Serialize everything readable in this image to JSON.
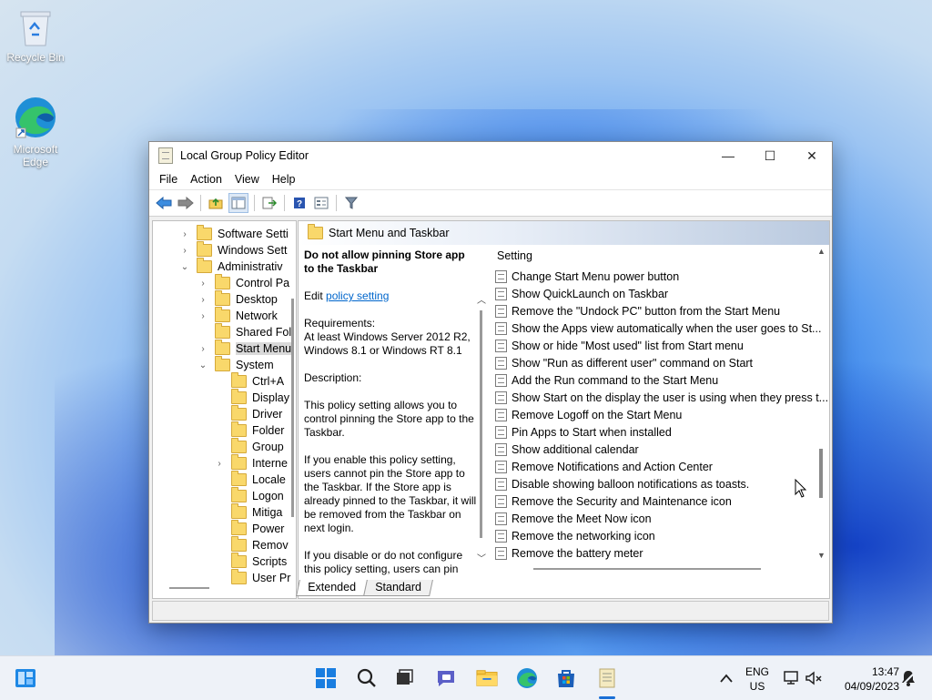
{
  "desktop": {
    "icons": [
      {
        "label_line1": "Recycle Bin",
        "label_line2": ""
      },
      {
        "label_line1": "Microsoft",
        "label_line2": "Edge"
      }
    ]
  },
  "window": {
    "title": "Local Group Policy Editor",
    "controls": {
      "minimize": "—",
      "maximize": "☐",
      "close": "✕"
    },
    "menu": [
      "File",
      "Action",
      "View",
      "Help"
    ]
  },
  "tree": {
    "items": [
      {
        "label": "Software Setti",
        "expander": "›"
      },
      {
        "label": "Windows Sett",
        "expander": "›"
      },
      {
        "label": "Administrativ",
        "expander": "⌄"
      },
      {
        "label": "Control Pa",
        "expander": "›"
      },
      {
        "label": "Desktop",
        "expander": "›"
      },
      {
        "label": "Network",
        "expander": "›"
      },
      {
        "label": "Shared Fol",
        "expander": ""
      },
      {
        "label": "Start Menu",
        "expander": "›"
      },
      {
        "label": "System",
        "expander": "⌄"
      },
      {
        "label": "Ctrl+A",
        "expander": ""
      },
      {
        "label": "Display",
        "expander": ""
      },
      {
        "label": "Driver",
        "expander": ""
      },
      {
        "label": "Folder",
        "expander": ""
      },
      {
        "label": "Group",
        "expander": ""
      },
      {
        "label": "Interne",
        "expander": "›"
      },
      {
        "label": "Locale",
        "expander": ""
      },
      {
        "label": "Logon",
        "expander": ""
      },
      {
        "label": "Mitiga",
        "expander": ""
      },
      {
        "label": "Power",
        "expander": ""
      },
      {
        "label": "Remov",
        "expander": ""
      },
      {
        "label": "Scripts",
        "expander": ""
      },
      {
        "label": "User Pr",
        "expander": ""
      }
    ]
  },
  "pane": {
    "header": "Start Menu and Taskbar",
    "description": {
      "heading": "Do not allow pinning Store app to the Taskbar",
      "edit_prefix": "Edit ",
      "edit_link": "policy setting",
      "requirements_label": "Requirements:",
      "requirements_text": "At least Windows Server 2012 R2, Windows 8.1 or Windows RT 8.1",
      "description_label": "Description:",
      "para1": "This policy setting allows you to control pinning the Store app to the Taskbar.",
      "para2": "If you enable this policy setting, users cannot pin the Store app to the Taskbar. If the Store app is already pinned to the Taskbar, it will be removed from the Taskbar on next login.",
      "para3": "If you disable or do not configure this policy setting, users can pin"
    },
    "list_header": "Setting",
    "settings": [
      "Change Start Menu power button",
      "Show QuickLaunch on Taskbar",
      "Remove the \"Undock PC\" button from the Start Menu",
      "Show the Apps view automatically when the user goes to St...",
      "Show or hide \"Most used\" list from Start menu",
      "Show \"Run as different user\" command on Start",
      "Add the Run command to the Start Menu",
      "Show Start on the display the user is using when they press t...",
      "Remove Logoff on the Start Menu",
      "Pin Apps to Start when installed",
      "Show additional calendar",
      "Remove Notifications and Action Center",
      "Disable showing balloon notifications as toasts.",
      "Remove the Security and Maintenance icon",
      "Remove the Meet Now icon",
      "Remove the networking icon",
      "Remove the battery meter"
    ],
    "tabs": [
      "Extended",
      "Standard"
    ]
  },
  "taskbar": {
    "lang_line1": "ENG",
    "lang_line2": "US",
    "time": "13:47",
    "date": "04/09/2023"
  }
}
